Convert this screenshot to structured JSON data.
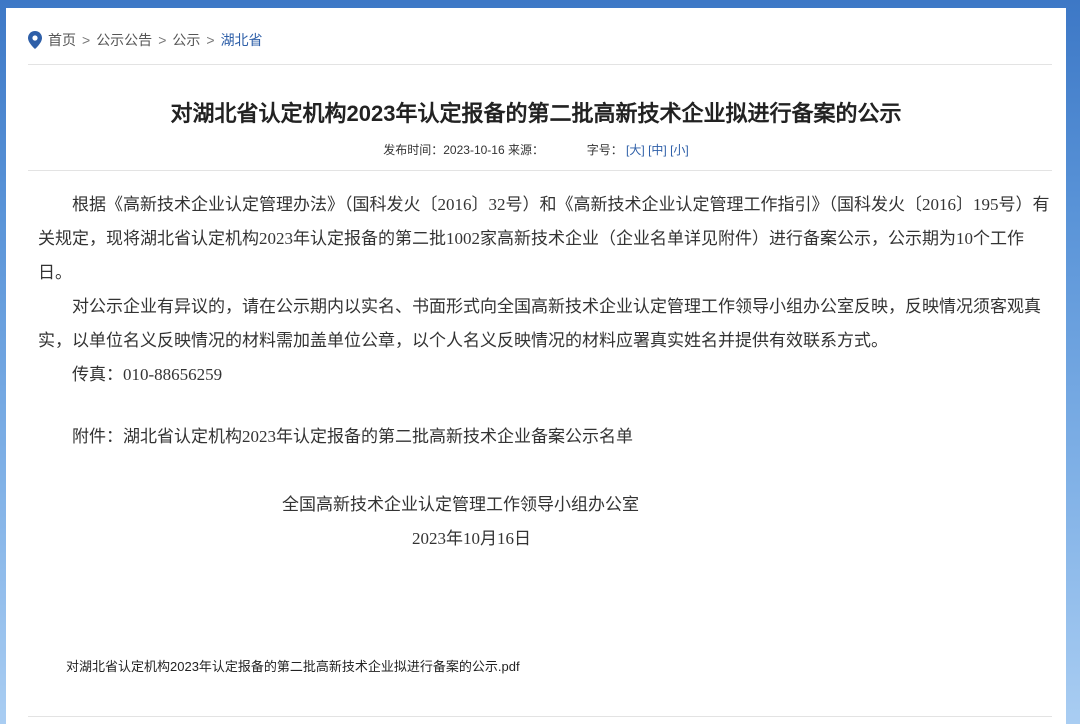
{
  "breadcrumb": {
    "items": [
      "首页",
      "公示公告",
      "公示",
      "湖北省"
    ],
    "separator": ">"
  },
  "article": {
    "title": "对湖北省认定机构2023年认定报备的第二批高新技术企业拟进行备案的公示",
    "meta": {
      "publish_label": "发布时间：",
      "publish_date": "2023-10-16",
      "source_label": "来源：",
      "source_value": "",
      "font_size_label": "字号：",
      "font_size_options": [
        "[大]",
        "[中]",
        "[小]"
      ]
    },
    "paragraphs": [
      "根据《高新技术企业认定管理办法》（国科发火〔2016〕32号）和《高新技术企业认定管理工作指引》（国科发火〔2016〕195号）有关规定，现将湖北省认定机构2023年认定报备的第二批1002家高新技术企业（企业名单详见附件）进行备案公示，公示期为10个工作日。",
      "对公示企业有异议的，请在公示期内以实名、书面形式向全国高新技术企业认定管理工作领导小组办公室反映，反映情况须客观真实，以单位名义反映情况的材料需加盖单位公章，以个人名义反映情况的材料应署真实姓名并提供有效联系方式。",
      "传真：010-88656259"
    ],
    "attachment_text": "附件：湖北省认定机构2023年认定报备的第二批高新技术企业备案公示名单",
    "signature": "全国高新技术企业认定管理工作领导小组办公室",
    "sign_date": "2023年10月16日",
    "attachment_link": "对湖北省认定机构2023年认定报备的第二批高新技术企业拟进行备案的公示.pdf"
  },
  "colors": {
    "link": "#2e5fa8",
    "background_top": "#3d78c6",
    "background_bottom": "#a9cdf2"
  }
}
